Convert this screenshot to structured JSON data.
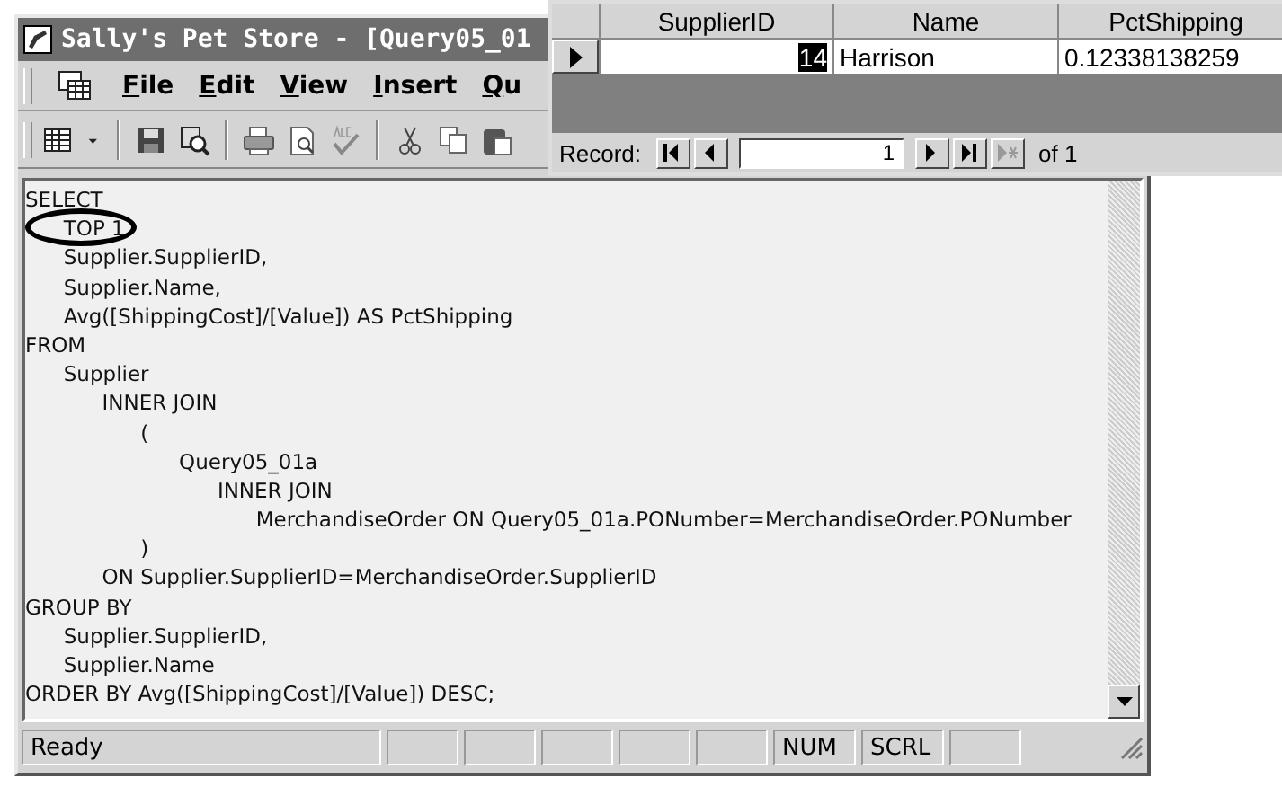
{
  "window": {
    "title": "Sally's Pet Store - [Query05_01"
  },
  "menu": [
    "File",
    "Edit",
    "View",
    "Insert",
    "Qu"
  ],
  "sql_editor": {
    "lines": [
      "SELECT",
      "   TOP 1",
      "   Supplier.SupplierID,",
      "   Supplier.Name,",
      "   Avg([ShippingCost]/[Value]) AS PctShipping",
      "FROM",
      "   Supplier",
      "      INNER JOIN",
      "         (",
      "            Query05_01a",
      "               INNER JOIN",
      "                  MerchandiseOrder ON Query05_01a.PONumber=MerchandiseOrder.PONumber",
      "         )",
      "      ON Supplier.SupplierID=MerchandiseOrder.SupplierID",
      "GROUP BY",
      "   Supplier.SupplierID,",
      "   Supplier.Name",
      "ORDER BY Avg([ShippingCost]/[Value]) DESC;"
    ]
  },
  "status_bar": {
    "message": "Ready",
    "indicators": [
      "NUM",
      "SCRL"
    ]
  },
  "datasheet": {
    "columns": [
      "SupplierID",
      "Name",
      "PctShipping"
    ],
    "rows": [
      {
        "cells": [
          "14",
          "Harrison",
          "0.12338138259"
        ],
        "selected": true
      }
    ],
    "navigator": {
      "label": "Record:",
      "current": "1",
      "total": "of 1"
    }
  }
}
